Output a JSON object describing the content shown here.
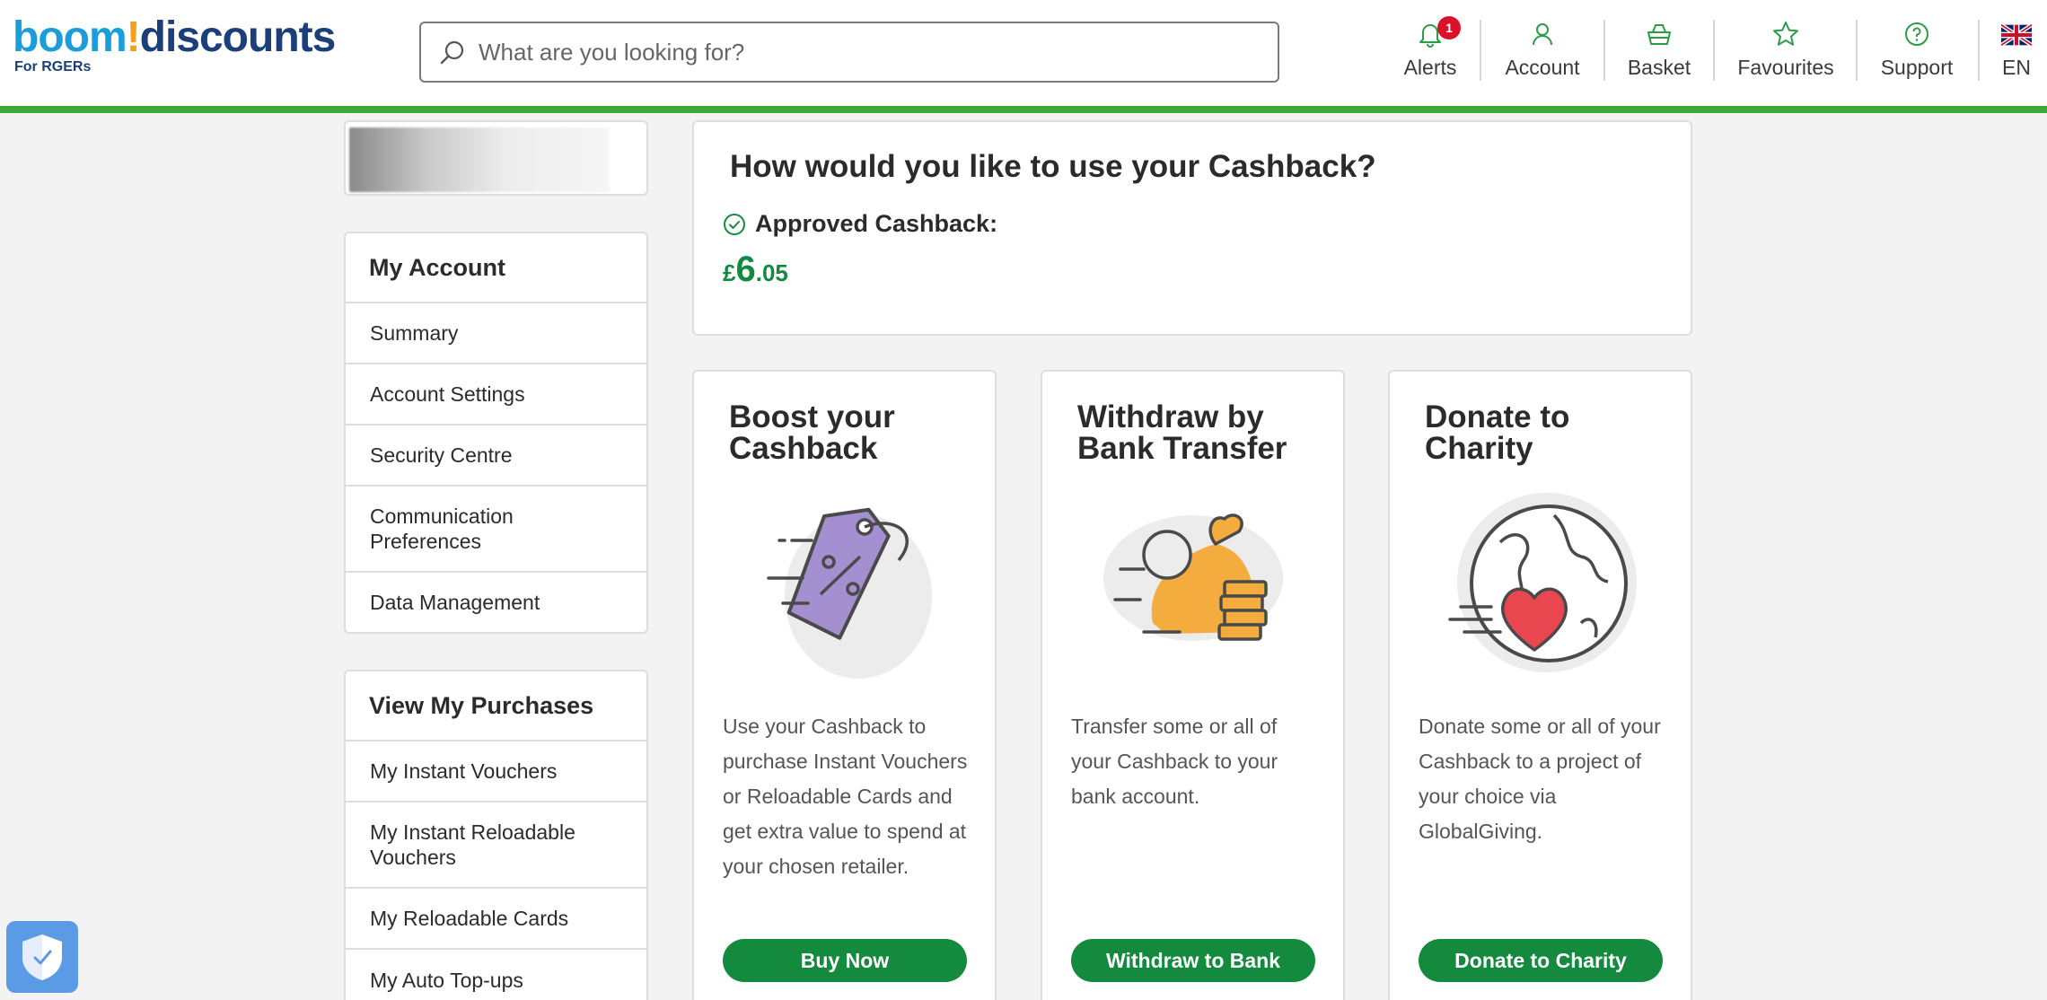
{
  "header": {
    "logo_boom": "boom",
    "logo_bang": "!",
    "logo_discounts": "discounts",
    "logo_sub": "For RGERs",
    "search_placeholder": "What are you looking for?",
    "alerts_label": "Alerts",
    "alerts_count": "1",
    "account_label": "Account",
    "basket_label": "Basket",
    "favourites_label": "Favourites",
    "support_label": "Support",
    "language_label": "EN"
  },
  "sidebar": {
    "account_title": "My Account",
    "account_items": [
      "Summary",
      "Account Settings",
      "Security Centre",
      "Communication Preferences",
      "Data Management"
    ],
    "purchases_title": "View My Purchases",
    "purchase_items": [
      "My Instant Vouchers",
      "My Instant Reloadable Vouchers",
      "My Reloadable Cards",
      "My Auto Top-ups"
    ]
  },
  "cashback": {
    "title": "How would you like to use your Cashback?",
    "approved_label": "Approved Cashback:",
    "currency": "£",
    "amount_major": "6",
    "amount_minor": ".05"
  },
  "options": [
    {
      "title": "Boost your Cashback",
      "description": "Use your Cashback to purchase Instant Vouchers or Reloadable Cards and get extra value to spend at your chosen retailer.",
      "button": "Buy Now",
      "icon": "price-tag-icon"
    },
    {
      "title": "Withdraw by Bank Transfer",
      "description": "Transfer some or all of your Cashback to your bank account.",
      "button": "Withdraw to Bank",
      "icon": "money-bag-icon"
    },
    {
      "title": "Donate to Charity",
      "description": "Donate some or all of your Cashback to a project of your choice via GlobalGiving.",
      "button": "Donate to Charity",
      "icon": "globe-heart-icon"
    }
  ],
  "colors": {
    "brand_green": "#138a3d",
    "header_bar": "#3aaa35",
    "alert_badge": "#d9112a",
    "tag_purple": "#a48fd1",
    "bag_orange": "#f5ac3e",
    "heart_red": "#e8474f"
  }
}
